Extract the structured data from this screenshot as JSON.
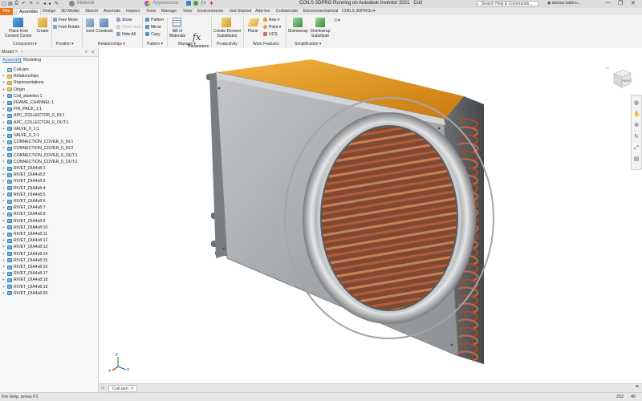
{
  "titlebar": {
    "quick_access": [
      "⎙",
      "↶",
      "↷",
      "⌂",
      "◂",
      "▸",
      "✎"
    ],
    "material": "Material",
    "appearance": "Appearance",
    "title": "COILS 3DPRO Running on Autodesk Inventor 2021",
    "doc": "Coil",
    "search_placeholder": "Search Help & Commands...",
    "user": "slavisa.todoro...",
    "window_controls": [
      "—",
      "❐",
      "✕"
    ]
  },
  "menu": {
    "tabs": [
      "File",
      "Assemble",
      "Design",
      "3D Model",
      "Sketch",
      "Annotate",
      "Inspect",
      "Tools",
      "Manage",
      "View",
      "Environments",
      "Get Started",
      "Add-Ins",
      "Collaborate",
      "Electromechanical",
      "COILS 3DPRO"
    ],
    "active": "Assemble"
  },
  "ribbon": {
    "place": "Place from\nContent Center",
    "create": "Create",
    "free_move": "Free Move",
    "free_rotate": "Free Rotate",
    "joint": "Joint",
    "constrain": "Constrain",
    "show": "Show",
    "show_sick": "Show Sick",
    "hide_all": "Hide All",
    "pattern": "Pattern",
    "mirror": "Mirror",
    "copy": "Copy",
    "bill_of_materials": "Bill of\nMaterials",
    "parameters": "Parameters",
    "create_derived": "Create Derived\nSubstitutes",
    "plane": "Plane",
    "axis": "Axis",
    "point": "Point",
    "ucs": "UCS",
    "shrinkwrap": "Shrinkwrap",
    "shrinkwrap_substitute": "Shrinkwrap\nSubstitute",
    "groups": {
      "component": "Component ▾",
      "position": "Position ▾",
      "relationships": "Relationships ▾",
      "pattern": "Pattern ▾",
      "manage": "Manage ▾",
      "productivity": "Productivity",
      "work_features": "Work Features",
      "simplification": "Simplification ▾"
    }
  },
  "panel": {
    "header": "Model",
    "close": "✕",
    "add": "+",
    "search_icon": "⌕",
    "menu_icon": "≡",
    "tab_assembly": "Assembly",
    "tab_modeling": "Modeling",
    "tree": [
      {
        "label": "Coil.iam",
        "icon": "root",
        "pm": ""
      },
      {
        "label": "Relationships",
        "icon": "folder",
        "pm": "+"
      },
      {
        "label": "Representations",
        "icon": "folder",
        "pm": "+"
      },
      {
        "label": "Origin",
        "icon": "folder",
        "pm": "+"
      },
      {
        "label": "Coil_skeleton:1",
        "icon": "part",
        "pm": "+"
      },
      {
        "label": "FRAME_CHANNEL:1",
        "icon": "part",
        "pm": "+"
      },
      {
        "label": "FIN_PACK_1:1",
        "icon": "part",
        "pm": "+"
      },
      {
        "label": "APC_COLLECTOR_0_IN:1",
        "icon": "part",
        "pm": "+"
      },
      {
        "label": "APC_COLLECTOR_0_OUT:1",
        "icon": "part",
        "pm": "+"
      },
      {
        "label": "VALVE_0_1:1",
        "icon": "part",
        "pm": "+"
      },
      {
        "label": "VALVE_0_2:1",
        "icon": "part",
        "pm": "+"
      },
      {
        "label": "CONNECTION_COVER_0_IN:1",
        "icon": "part",
        "pm": "+"
      },
      {
        "label": "CONNECTION_COVER_0_IN:2",
        "icon": "part",
        "pm": "+"
      },
      {
        "label": "CONNECTION_COVER_0_OUT:1",
        "icon": "part",
        "pm": "+"
      },
      {
        "label": "CONNECTION_COVER_0_OUT:2",
        "icon": "part",
        "pm": "+"
      },
      {
        "label": "RIVET_DIA4x8:1",
        "icon": "part",
        "pm": "+"
      },
      {
        "label": "RIVET_DIA4x8:2",
        "icon": "part",
        "pm": "+"
      },
      {
        "label": "RIVET_DIA4x8:3",
        "icon": "part",
        "pm": "+"
      },
      {
        "label": "RIVET_DIA4x8:4",
        "icon": "part",
        "pm": "+"
      },
      {
        "label": "RIVET_DIA4x8:5",
        "icon": "part",
        "pm": "+"
      },
      {
        "label": "RIVET_DIA4x8:6",
        "icon": "part",
        "pm": "+"
      },
      {
        "label": "RIVET_DIA4x8:7",
        "icon": "part",
        "pm": "+"
      },
      {
        "label": "RIVET_DIA4x8:8",
        "icon": "part",
        "pm": "+"
      },
      {
        "label": "RIVET_DIA4x8:9",
        "icon": "part",
        "pm": "+"
      },
      {
        "label": "RIVET_DIA4x8:10",
        "icon": "part",
        "pm": "+"
      },
      {
        "label": "RIVET_DIA4x8:11",
        "icon": "part",
        "pm": "+"
      },
      {
        "label": "RIVET_DIA4x8:12",
        "icon": "part",
        "pm": "+"
      },
      {
        "label": "RIVET_DIA4x8:13",
        "icon": "part",
        "pm": "+"
      },
      {
        "label": "RIVET_DIA4x8:14",
        "icon": "part",
        "pm": "+"
      },
      {
        "label": "RIVET_DIA4x8:15",
        "icon": "part",
        "pm": "+"
      },
      {
        "label": "RIVET_DIA4x8:16",
        "icon": "part",
        "pm": "+"
      },
      {
        "label": "RIVET_DIA4x8:17",
        "icon": "part",
        "pm": "+"
      },
      {
        "label": "RIVET_DIA4x8:18",
        "icon": "part",
        "pm": "+"
      },
      {
        "label": "RIVET_DIA4x8:19",
        "icon": "part",
        "pm": "+"
      },
      {
        "label": "RIVET_DIA4x8:20",
        "icon": "part",
        "pm": "+"
      }
    ]
  },
  "viewcube": {
    "face": "RIGHT"
  },
  "navbar": [
    "◍",
    "✋",
    "⊕",
    "↻",
    "⤢",
    "▤"
  ],
  "doctabs": {
    "home": "⌂",
    "tab": "Coil.iam",
    "close": "✕",
    "menu": "≡"
  },
  "status": {
    "help": "For Help, press F1",
    "n1": "202",
    "n2": "40"
  },
  "colors": {
    "file_tab": "#e8751a",
    "copper": "#b85a35",
    "fins": "#e39a1f",
    "steel": "#a9acae"
  }
}
